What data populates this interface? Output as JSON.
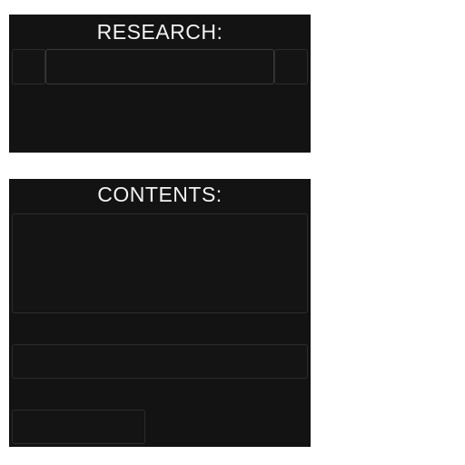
{
  "research": {
    "title": "RESEARCH:",
    "field_value": ""
  },
  "contents": {
    "title": "CONTENTS:",
    "list_text": "",
    "row_value": "",
    "button_label": ""
  },
  "colors": {
    "panel_bg": "#131313",
    "slot_border": "#2c2c2c",
    "title_text": "#f2f2f2"
  }
}
